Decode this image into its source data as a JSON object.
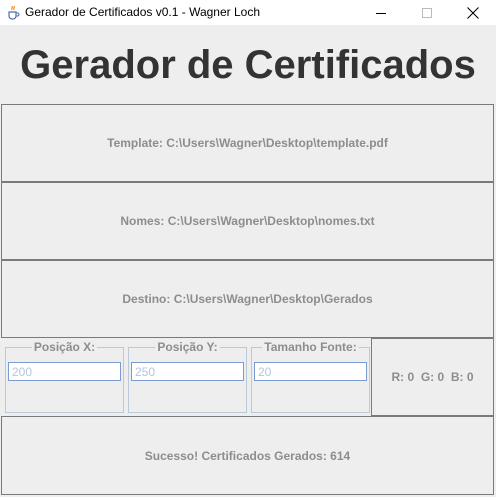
{
  "window": {
    "title": "Gerador de Certificados v0.1 - Wagner Loch",
    "icons": {
      "app": "java-cup-icon",
      "minimize": "minimize-icon",
      "maximize": "maximize-icon",
      "close": "close-icon"
    }
  },
  "header": {
    "title": "Gerador de Certificados"
  },
  "buttons": {
    "template": "Template: C:\\Users\\Wagner\\Desktop\\template.pdf",
    "nomes": "Nomes: C:\\Users\\Wagner\\Desktop\\nomes.txt",
    "destino": "Destino: C:\\Users\\Wagner\\Desktop\\Gerados",
    "status": "Sucesso! Certificados Gerados: 614"
  },
  "fields": {
    "posicao_x": {
      "label": "Posição X:",
      "value": "200"
    },
    "posicao_y": {
      "label": "Posição Y:",
      "value": "250"
    },
    "tamanho_fonte": {
      "label": "Tamanho Fonte:",
      "value": "20"
    }
  },
  "color_button": {
    "label": "R: 0  G: 0  B: 0"
  },
  "colors": {
    "text_disabled": "#8d8d8d",
    "background": "#eeeeee",
    "field_text": "#b3c6e0"
  }
}
